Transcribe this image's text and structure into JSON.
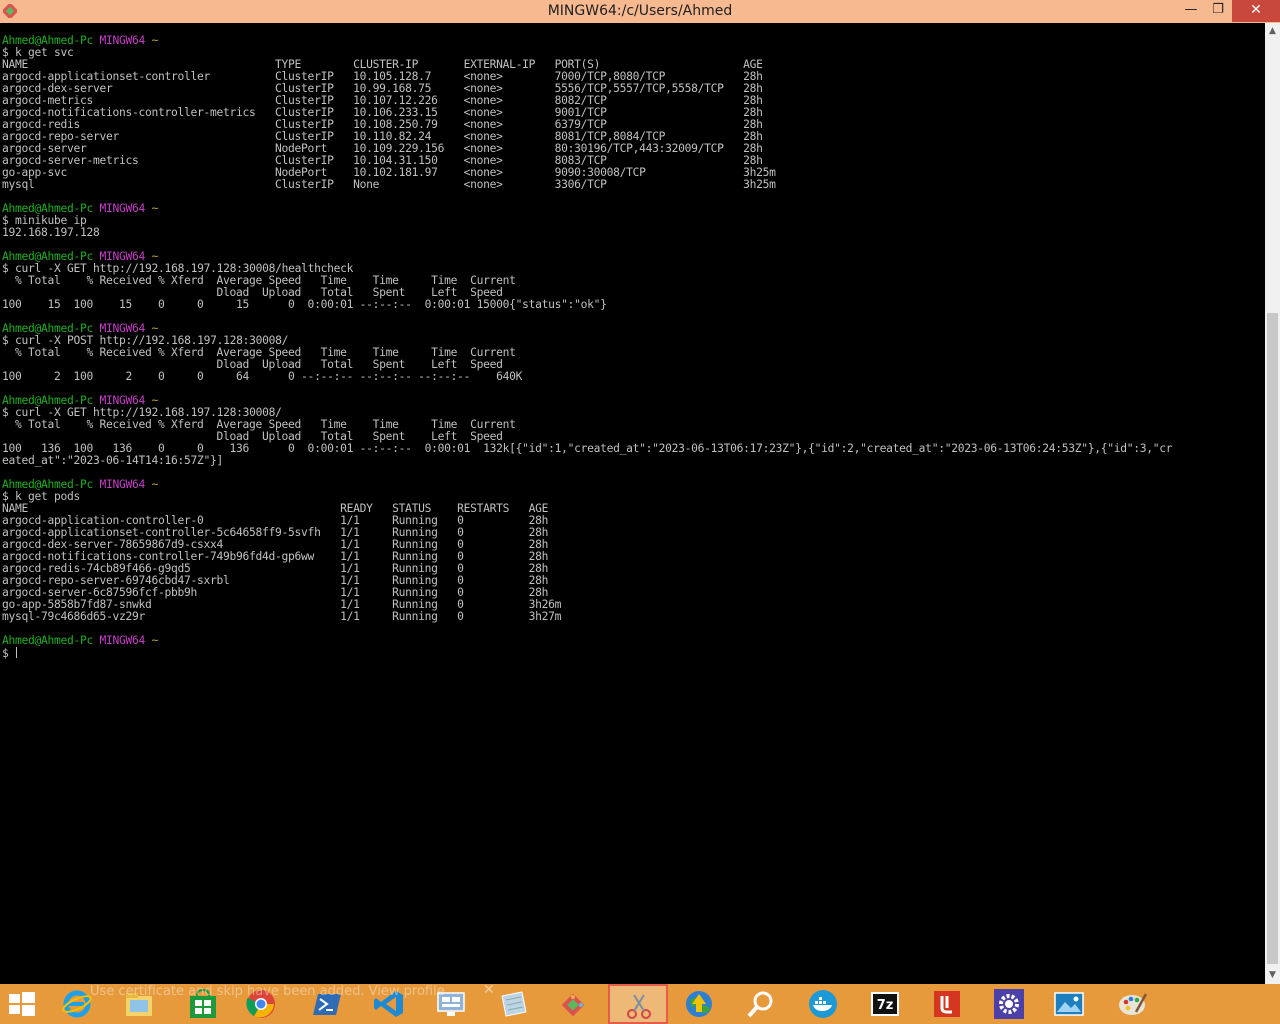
{
  "window": {
    "title": "MINGW64:/c/Users/Ahmed",
    "minimize_label": "—",
    "maximize_label": "❐",
    "close_label": "✕"
  },
  "colors": {
    "prompt_user": "#1fb11f",
    "prompt_shell": "#c340c3",
    "prompt_path": "#c9a227",
    "terminal_text": "#c0c0c0",
    "terminal_background": "#000000",
    "titlebar": "#f7b98f",
    "close_button": "#c9483d",
    "taskbar": "#e79a3c"
  },
  "prompt": {
    "user_host": "Ahmed@Ahmed-Pc",
    "shell": "MINGW64",
    "path": "~",
    "symbol": "$"
  },
  "blocks": [
    {
      "command": "k get svc",
      "output": [
        "NAME                                      TYPE        CLUSTER-IP       EXTERNAL-IP   PORT(S)                      AGE",
        "argocd-applicationset-controller          ClusterIP   10.105.128.7     <none>        7000/TCP,8080/TCP            28h",
        "argocd-dex-server                         ClusterIP   10.99.168.75     <none>        5556/TCP,5557/TCP,5558/TCP   28h",
        "argocd-metrics                            ClusterIP   10.107.12.226    <none>        8082/TCP                     28h",
        "argocd-notifications-controller-metrics   ClusterIP   10.106.233.15    <none>        9001/TCP                     28h",
        "argocd-redis                              ClusterIP   10.108.250.79    <none>        6379/TCP                     28h",
        "argocd-repo-server                        ClusterIP   10.110.82.24     <none>        8081/TCP,8084/TCP            28h",
        "argocd-server                             NodePort    10.109.229.156   <none>        80:30196/TCP,443:32009/TCP   28h",
        "argocd-server-metrics                     ClusterIP   10.104.31.150    <none>        8083/TCP                     28h",
        "go-app-svc                                NodePort    10.102.181.97    <none>        9090:30008/TCP               3h25m",
        "mysql                                     ClusterIP   None             <none>        3306/TCP                     3h25m"
      ]
    },
    {
      "command": "minikube ip",
      "output": [
        "192.168.197.128"
      ]
    },
    {
      "command": "curl -X GET http://192.168.197.128:30008/healthcheck",
      "output": [
        "  % Total    % Received % Xferd  Average Speed   Time    Time     Time  Current",
        "                                 Dload  Upload   Total   Spent    Left  Speed",
        "100    15  100    15    0     0     15      0  0:00:01 --:--:--  0:00:01 15000{\"status\":\"ok\"}"
      ]
    },
    {
      "command": "curl -X POST http://192.168.197.128:30008/",
      "output": [
        "  % Total    % Received % Xferd  Average Speed   Time    Time     Time  Current",
        "                                 Dload  Upload   Total   Spent    Left  Speed",
        "100     2  100     2    0     0     64      0 --:--:-- --:--:-- --:--:--    640K"
      ]
    },
    {
      "command": "curl -X GET http://192.168.197.128:30008/",
      "output": [
        "  % Total    % Received % Xferd  Average Speed   Time    Time     Time  Current",
        "                                 Dload  Upload   Total   Spent    Left  Speed",
        "100   136  100   136    0     0    136      0  0:00:01 --:--:--  0:00:01  132k[{\"id\":1,\"created_at\":\"2023-06-13T06:17:23Z\"},{\"id\":2,\"created_at\":\"2023-06-13T06:24:53Z\"},{\"id\":3,\"cr",
        "eated_at\":\"2023-06-14T14:16:57Z\"}]"
      ]
    },
    {
      "command": "k get pods",
      "output": [
        "NAME                                                READY   STATUS    RESTARTS   AGE",
        "argocd-application-controller-0                     1/1     Running   0          28h",
        "argocd-applicationset-controller-5c64658ff9-5svfh   1/1     Running   0          28h",
        "argocd-dex-server-78659867d9-csxx4                  1/1     Running   0          28h",
        "argocd-notifications-controller-749b96fd4d-gp6ww    1/1     Running   0          28h",
        "argocd-redis-74cb89f466-g9qd5                       1/1     Running   0          28h",
        "argocd-repo-server-69746cbd47-sxrbl                 1/1     Running   0          28h",
        "argocd-server-6c87596fcf-pbb9h                      1/1     Running   0          28h",
        "go-app-5858b7fd87-snwkd                             1/1     Running   0          3h26m",
        "mysql-79c4686d65-vz29r                              1/1     Running   0          3h27m"
      ]
    }
  ],
  "scrollbar": {
    "up_arrow": "▲",
    "down_arrow": "▼"
  },
  "taskbar": {
    "notification_text": "Use certificate and skip have been added. View profile",
    "notification_close": "✕",
    "items": [
      {
        "icon": "windows-start-icon"
      },
      {
        "icon": "internet-explorer-icon"
      },
      {
        "icon": "file-explorer-icon"
      },
      {
        "icon": "windows-store-icon"
      },
      {
        "icon": "chrome-icon"
      },
      {
        "icon": "powershell-icon"
      },
      {
        "icon": "vscode-icon"
      },
      {
        "icon": "remote-desktop-icon"
      },
      {
        "icon": "notepad-icon"
      },
      {
        "icon": "git-bash-icon"
      },
      {
        "icon": "snipping-tool-icon",
        "active": true
      },
      {
        "icon": "idm-globe-icon"
      },
      {
        "icon": "search-magnifier-icon"
      },
      {
        "icon": "docker-icon"
      },
      {
        "icon": "7zip-icon",
        "label": "7z"
      },
      {
        "icon": "acrobat-icon"
      },
      {
        "icon": "settings-gear-icon"
      },
      {
        "icon": "photos-icon"
      },
      {
        "icon": "paint-icon"
      }
    ]
  }
}
